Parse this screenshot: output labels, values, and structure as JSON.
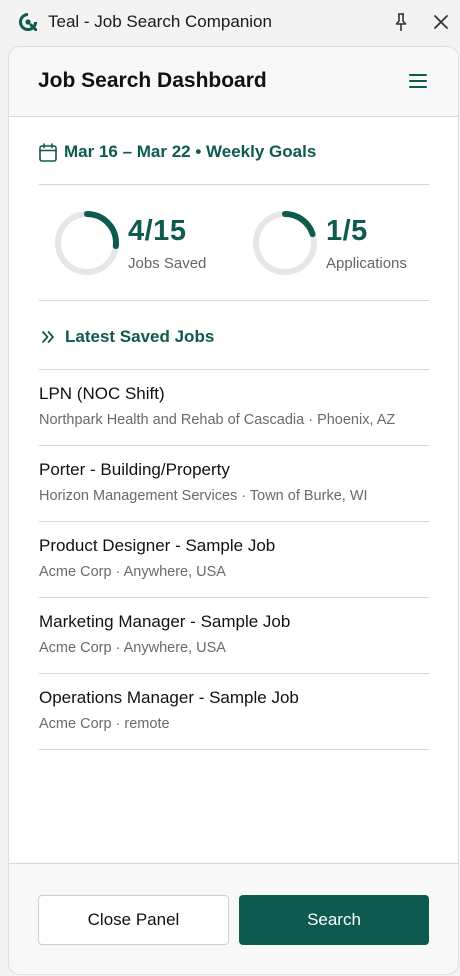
{
  "window": {
    "title": "Teal - Job Search Companion",
    "logo_icon": "teal-logo-icon",
    "pin_icon": "pin-icon",
    "close_icon": "close-icon"
  },
  "header": {
    "title": "Job Search Dashboard",
    "menu_icon": "hamburger-menu-icon"
  },
  "week": {
    "icon": "calendar-icon",
    "label": "Mar 16 – Mar 22 • Weekly Goals"
  },
  "goals": [
    {
      "value": "4/15",
      "label": "Jobs Saved",
      "progress": 0.2667
    },
    {
      "value": "1/5",
      "label": "Applications",
      "progress": 0.2
    }
  ],
  "latest": {
    "icon": "double-chevron-right-icon",
    "label": "Latest Saved Jobs"
  },
  "jobs": [
    {
      "title": "LPN (NOC Shift)",
      "meta": "Northpark Health and Rehab of Cascadia · Phoenix, AZ"
    },
    {
      "title": "Porter - Building/Property",
      "meta": "Horizon Management Services · Town of Burke, WI"
    },
    {
      "title": "Product Designer - Sample Job",
      "meta": "Acme Corp · Anywhere, USA"
    },
    {
      "title": "Marketing Manager - Sample Job",
      "meta": "Acme Corp · Anywhere, USA"
    },
    {
      "title": "Operations Manager - Sample Job",
      "meta": "Acme Corp · remote"
    }
  ],
  "footer": {
    "close_label": "Close Panel",
    "search_label": "Search"
  },
  "colors": {
    "accent": "#0e5a4f",
    "ring_track": "#e6e6e6"
  }
}
